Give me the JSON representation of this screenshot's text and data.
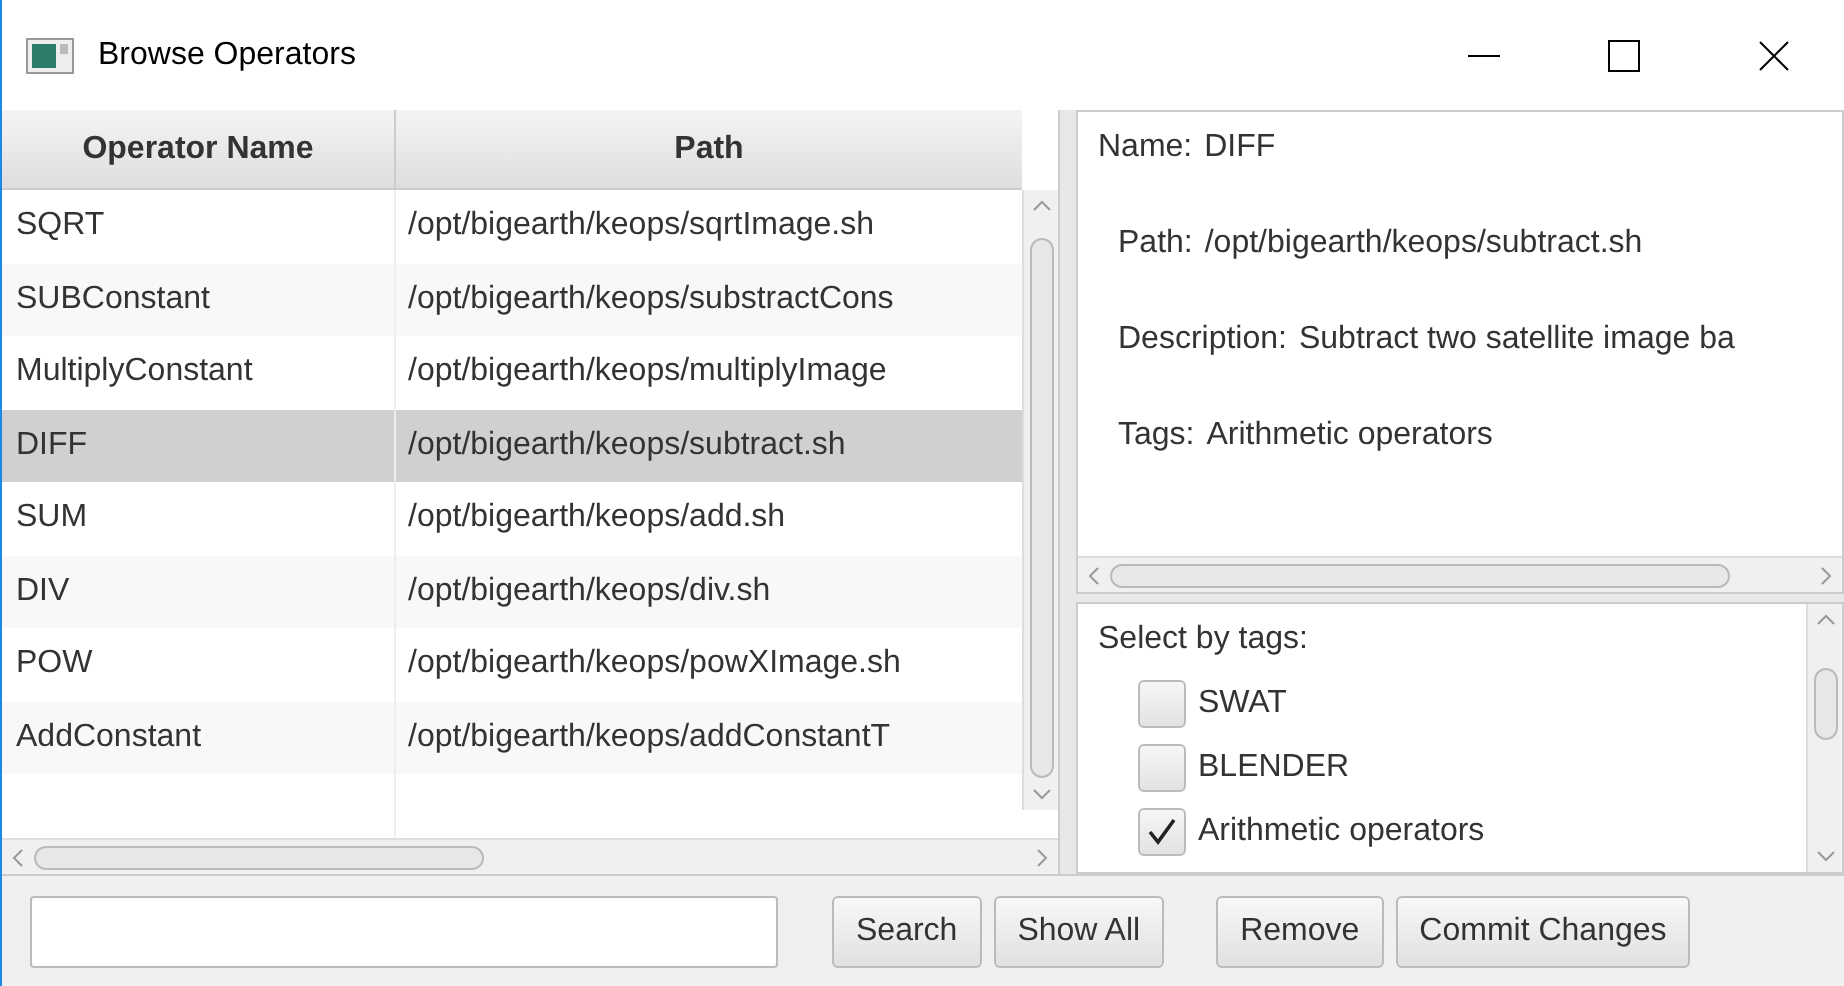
{
  "window": {
    "title": "Browse Operators"
  },
  "table": {
    "columns": [
      "Operator Name",
      "Path"
    ],
    "rows": [
      {
        "name": "SQRT",
        "path": "/opt/bigearth/keops/sqrtImage.sh",
        "selected": false
      },
      {
        "name": "SUBConstant",
        "path": "/opt/bigearth/keops/substractCons",
        "selected": false
      },
      {
        "name": "MultiplyConstant",
        "path": "/opt/bigearth/keops/multiplyImage",
        "selected": false
      },
      {
        "name": "DIFF",
        "path": "/opt/bigearth/keops/subtract.sh",
        "selected": true
      },
      {
        "name": "SUM",
        "path": "/opt/bigearth/keops/add.sh",
        "selected": false
      },
      {
        "name": "DIV",
        "path": "/opt/bigearth/keops/div.sh",
        "selected": false
      },
      {
        "name": "POW",
        "path": "/opt/bigearth/keops/powXImage.sh",
        "selected": false
      },
      {
        "name": "AddConstant",
        "path": "/opt/bigearth/keops/addConstantT",
        "selected": false
      }
    ]
  },
  "details": [
    {
      "label": "Name:",
      "value": "DIFF"
    },
    {
      "label": "Path:",
      "value": "/opt/bigearth/keops/subtract.sh"
    },
    {
      "label": "Description:",
      "value": "Subtract two satellite image ba"
    },
    {
      "label": "Tags:",
      "value": "Arithmetic operators"
    }
  ],
  "tag_filter": {
    "label": "Select by tags:",
    "tags": [
      {
        "label": "SWAT",
        "checked": false
      },
      {
        "label": "BLENDER",
        "checked": false
      },
      {
        "label": "Arithmetic operators",
        "checked": true
      }
    ]
  },
  "buttons": [
    "Search",
    "Show All",
    "Remove",
    "Commit Changes"
  ]
}
